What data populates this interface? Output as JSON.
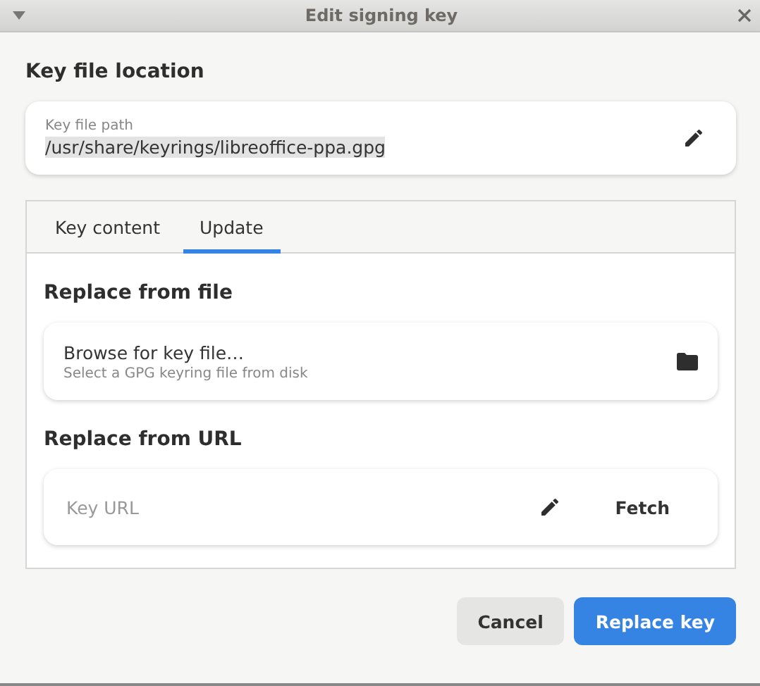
{
  "window": {
    "title": "Edit signing key"
  },
  "location": {
    "heading": "Key file location",
    "field": {
      "label": "Key file path",
      "value": "/usr/share/keyrings/libreoffice-ppa.gpg",
      "text_selected": true
    }
  },
  "tabs": [
    {
      "label": "Key content",
      "selected": false
    },
    {
      "label": "Update",
      "selected": true
    }
  ],
  "update": {
    "file_heading": "Replace from file",
    "browse": {
      "title": "Browse for key file…",
      "subtitle": "Select a GPG keyring file from disk"
    },
    "url_heading": "Replace from URL",
    "url": {
      "placeholder": "Key URL",
      "button": "Fetch"
    }
  },
  "buttons": [
    {
      "label": "Cancel",
      "kind": "secondary"
    },
    {
      "label": "Replace key",
      "kind": "primary"
    }
  ]
}
